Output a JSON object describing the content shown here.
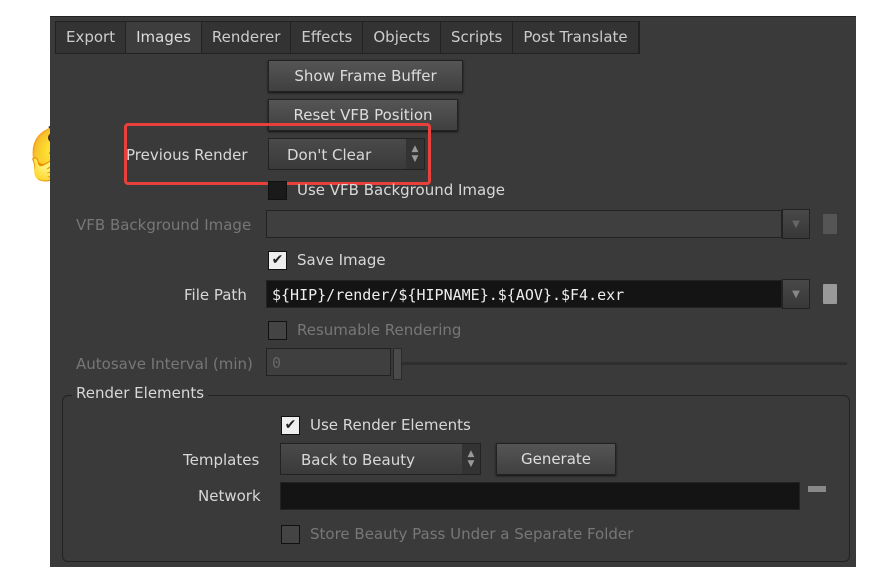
{
  "tabs": [
    "Export",
    "Images",
    "Renderer",
    "Effects",
    "Objects",
    "Scripts",
    "Post Translate"
  ],
  "active_tab": "Images",
  "show_frame_buffer": "Show Frame Buffer",
  "reset_vfb_position": "Reset VFB Position",
  "previous_render": {
    "label": "Previous Render",
    "value": "Don't Clear"
  },
  "use_vfb_bg": {
    "label": "Use VFB Background Image",
    "checked": false
  },
  "vfb_bg_image": {
    "label": "VFB Background Image",
    "value": ""
  },
  "save_image": {
    "label": "Save Image",
    "checked": true
  },
  "file_path": {
    "label": "File Path",
    "value": "${HIP}/render/${HIPNAME}.${AOV}.$F4.exr"
  },
  "resumable": {
    "label": "Resumable Rendering",
    "checked": false
  },
  "autosave": {
    "label": "Autosave Interval (min)",
    "value": "0"
  },
  "render_elements": {
    "title": "Render Elements",
    "use": {
      "label": "Use Render Elements",
      "checked": true
    },
    "templates": {
      "label": "Templates",
      "value": "Back to Beauty"
    },
    "generate": "Generate",
    "network": {
      "label": "Network",
      "value": ""
    },
    "store_beauty": {
      "label": "Store Beauty Pass Under a Separate Folder",
      "checked": false
    }
  },
  "highlight_color": "#e8413c"
}
